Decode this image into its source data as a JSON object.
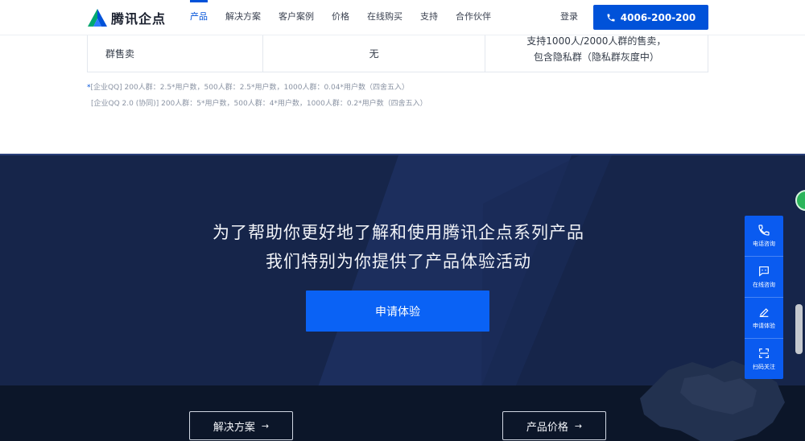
{
  "header": {
    "logo_text": "腾讯企点",
    "nav": [
      "产品",
      "解决方案",
      "客户案例",
      "价格",
      "在线购买",
      "支持",
      "合作伙伴"
    ],
    "login": "登录",
    "phone": "4006-200-200",
    "brand_color": "#0052d9"
  },
  "table": {
    "row": {
      "feature": "群售卖",
      "col2": "无",
      "col3_line1": "支持1000人/2000人群的售卖，",
      "col3_line2": "包含隐私群（隐私群灰度中）"
    }
  },
  "notes": {
    "star": "*",
    "line1": "[企业QQ] 200人群：2.5*用户数，500人群：2.5*用户数，1000人群：0.04*用户数（四舍五入）",
    "line2": "[企业QQ 2.0 (协同)] 200人群：5*用户数，500人群：4*用户数，1000人群：0.2*用户数（四舍五入）"
  },
  "banner": {
    "title_line1": "为了帮助你更好地了解和使用腾讯企点系列产品",
    "title_line2": "我们特别为你提供了产品体验活动",
    "apply_label": "申请体验",
    "bg_color": "#16254a"
  },
  "footer": {
    "btn1": "解决方案",
    "btn2": "产品价格",
    "arrow": "→"
  },
  "float_bar": {
    "items": [
      {
        "label": "电话咨询",
        "icon": "phone-icon"
      },
      {
        "label": "在线咨询",
        "icon": "chat-icon"
      },
      {
        "label": "申请体验",
        "icon": "pen-icon"
      },
      {
        "label": "扫码关注",
        "icon": "qr-scan-icon"
      }
    ]
  }
}
